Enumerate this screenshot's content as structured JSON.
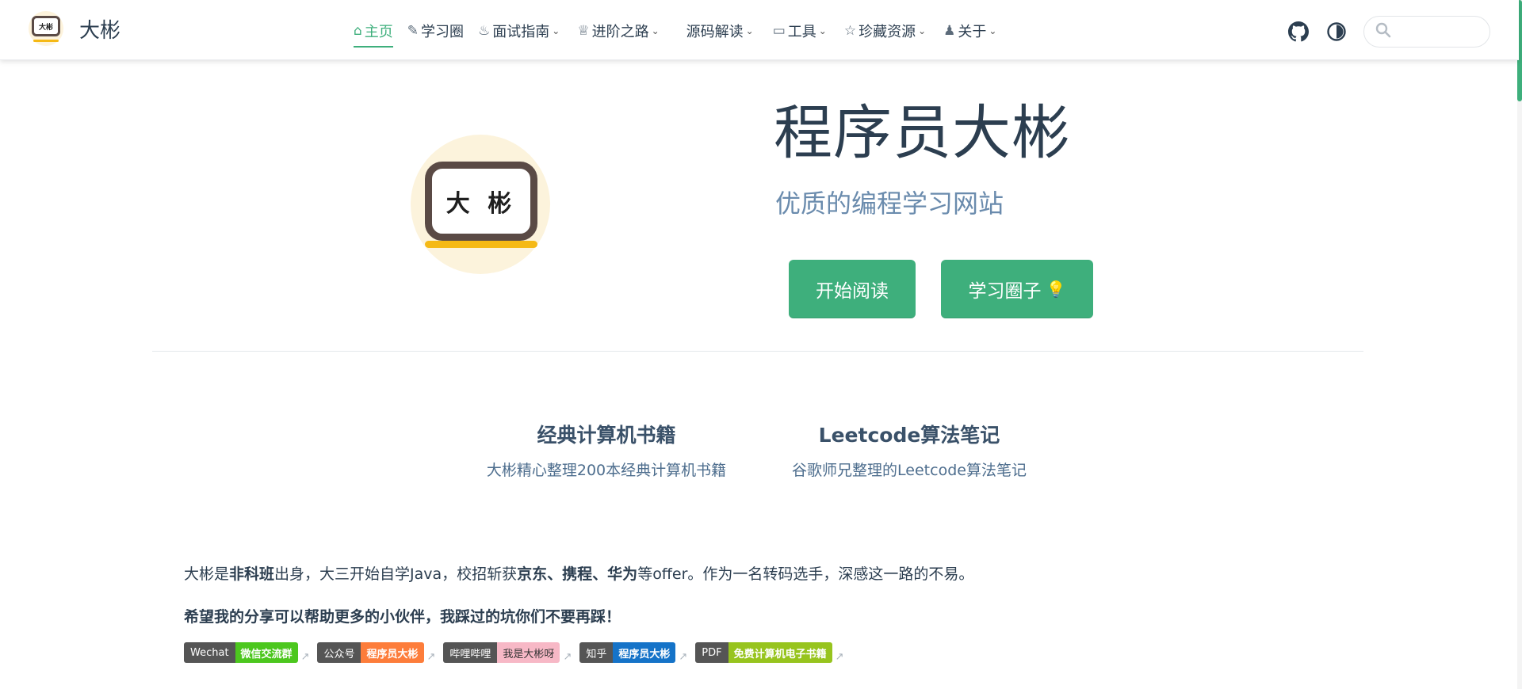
{
  "brand": {
    "name": "大彬",
    "logo_text": "大彬"
  },
  "nav": {
    "items": [
      {
        "label": "主页",
        "icon": "home-icon",
        "icon_glyph": "⌂",
        "dropdown": false,
        "active": true
      },
      {
        "label": "学习圈",
        "icon": "leaf-icon",
        "icon_glyph": "✎",
        "dropdown": false,
        "active": false
      },
      {
        "label": "面试指南",
        "icon": "java-icon",
        "icon_glyph": "♨",
        "dropdown": true,
        "active": false
      },
      {
        "label": "进阶之路",
        "icon": "trophy-icon",
        "icon_glyph": "♕",
        "dropdown": true,
        "active": false
      },
      {
        "label": "源码解读",
        "icon": "",
        "icon_glyph": "",
        "dropdown": true,
        "active": false
      },
      {
        "label": "工具",
        "icon": "toolbox-icon",
        "icon_glyph": "▭",
        "dropdown": true,
        "active": false
      },
      {
        "label": "珍藏资源",
        "icon": "star-icon",
        "icon_glyph": "☆",
        "dropdown": true,
        "active": false
      },
      {
        "label": "关于",
        "icon": "people-icon",
        "icon_glyph": "♟",
        "dropdown": true,
        "active": false
      }
    ],
    "search_placeholder": ""
  },
  "hero": {
    "title": "程序员大彬",
    "subtitle": "优质的编程学习网站",
    "logo_text": "大 彬",
    "actions": [
      {
        "label": "开始阅读"
      },
      {
        "label": "学习圈子"
      }
    ]
  },
  "features": [
    {
      "title": "经典计算机书籍",
      "details": "大彬精心整理200本经典计算机书籍"
    },
    {
      "title": "Leetcode算法笔记",
      "details": "谷歌师兄整理的Leetcode算法笔记"
    }
  ],
  "intro": {
    "p1": [
      "大彬是",
      "非科班",
      "出身，大三开始自学Java，校招斩获",
      "京东、携程、华为",
      "等offer。作为一名转码选手，深感这一路的不易。"
    ],
    "p2": "希望我的分享可以帮助更多的小伙伴，我踩过的坑你们不要再踩！"
  },
  "badges": [
    {
      "left": "Wechat",
      "right": "微信交流群",
      "color": "#4cc71e"
    },
    {
      "left": "公众号",
      "right": "程序员大彬",
      "color": "#fd7d3b"
    },
    {
      "left": "哔哩哔哩",
      "right": "我是大彬呀",
      "color": "#f7b8c6"
    },
    {
      "left": "知乎",
      "right": "程序员大彬",
      "color": "#1573c8"
    },
    {
      "left": "PDF",
      "right": "免费计算机电子书籍",
      "color": "#97c41e"
    }
  ],
  "colors": {
    "accent": "#3eaf7c",
    "text": "#2c3e50",
    "subtitle": "#6a8bad"
  }
}
